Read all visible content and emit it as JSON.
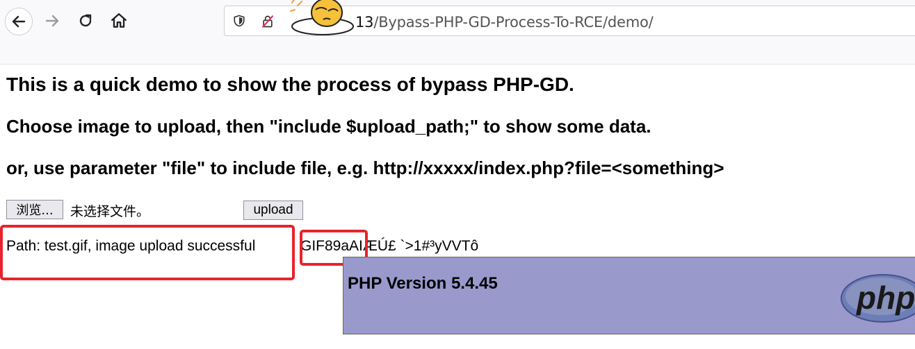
{
  "browser": {
    "url_host": "13",
    "url_path": "/Bypass-PHP-GD-Process-To-RCE/demo/"
  },
  "page": {
    "heading_1": "This is a quick demo to show the process of bypass PHP-GD.",
    "heading_2": "Choose image to upload, then \"include $upload_path;\" to show some data.",
    "heading_3": "or, use parameter \"file\" to include file, e.g. http://xxxxx/index.php?file=<something>",
    "browse_label": "浏览...",
    "no_file_text": "未选择文件。",
    "upload_label": "upload",
    "path_text": "Path: test.gif, image upload successful",
    "gif_output": "GIF89aAIÆÚ£ `>1#³yVVTô",
    "php_version": "PHP Version 5.4.45",
    "php_logo_text": "php"
  },
  "colors": {
    "highlight_red": "#e8232b",
    "phpinfo_bg": "#9999cc"
  }
}
